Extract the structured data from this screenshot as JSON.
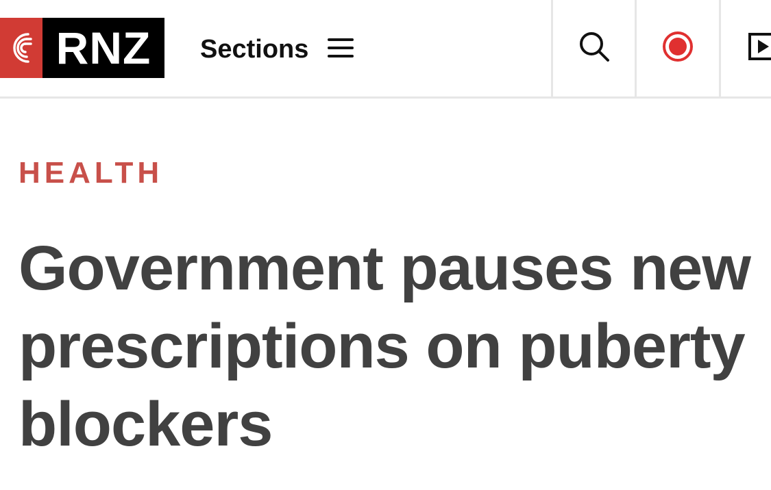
{
  "header": {
    "logo_text": "RNZ",
    "sections_label": "Sections",
    "icons": {
      "logo_mark": "rnz-swirl-icon",
      "menu": "hamburger-menu-icon",
      "search": "search-icon",
      "live": "live-radio-icon",
      "play": "play-icon"
    },
    "colors": {
      "brand_red": "#d13b34",
      "logo_black": "#000000",
      "live_red": "#e03030"
    }
  },
  "article": {
    "category": "HEALTH",
    "category_color": "#c8504a",
    "headline": "Government pauses new prescriptions on puberty blockers",
    "headline_color": "#414141"
  }
}
